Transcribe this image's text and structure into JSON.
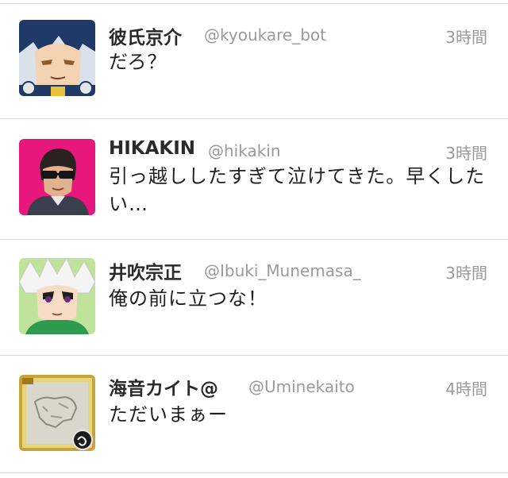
{
  "tweets": [
    {
      "name": "彼氏京介",
      "handle": "@kyoukare_bot",
      "time": "3時間",
      "text": "だろ？",
      "avatar": "anime-character-blue-hair"
    },
    {
      "name": "HIKAKIN",
      "handle": "@hikakin",
      "time": "3時間",
      "text": "引っ越ししたすぎて泣けてきた。早くしたい…",
      "avatar": "person-sunglasses-pink-background"
    },
    {
      "name": "井吹宗正",
      "handle": "@Ibuki_Munemasa_",
      "time": "3時間",
      "text": "俺の前に立つな！",
      "avatar": "anime-character-white-hair"
    },
    {
      "name": "海音カイト@",
      "handle": "@Uminekaito",
      "time": "4時間",
      "text": "ただいまぁー",
      "avatar": "gold-framed-card"
    }
  ],
  "colors": {
    "name": "#2a2a2a",
    "meta": "#9a9a9a",
    "separator": "#d9d9d9",
    "background": "#ffffff"
  }
}
